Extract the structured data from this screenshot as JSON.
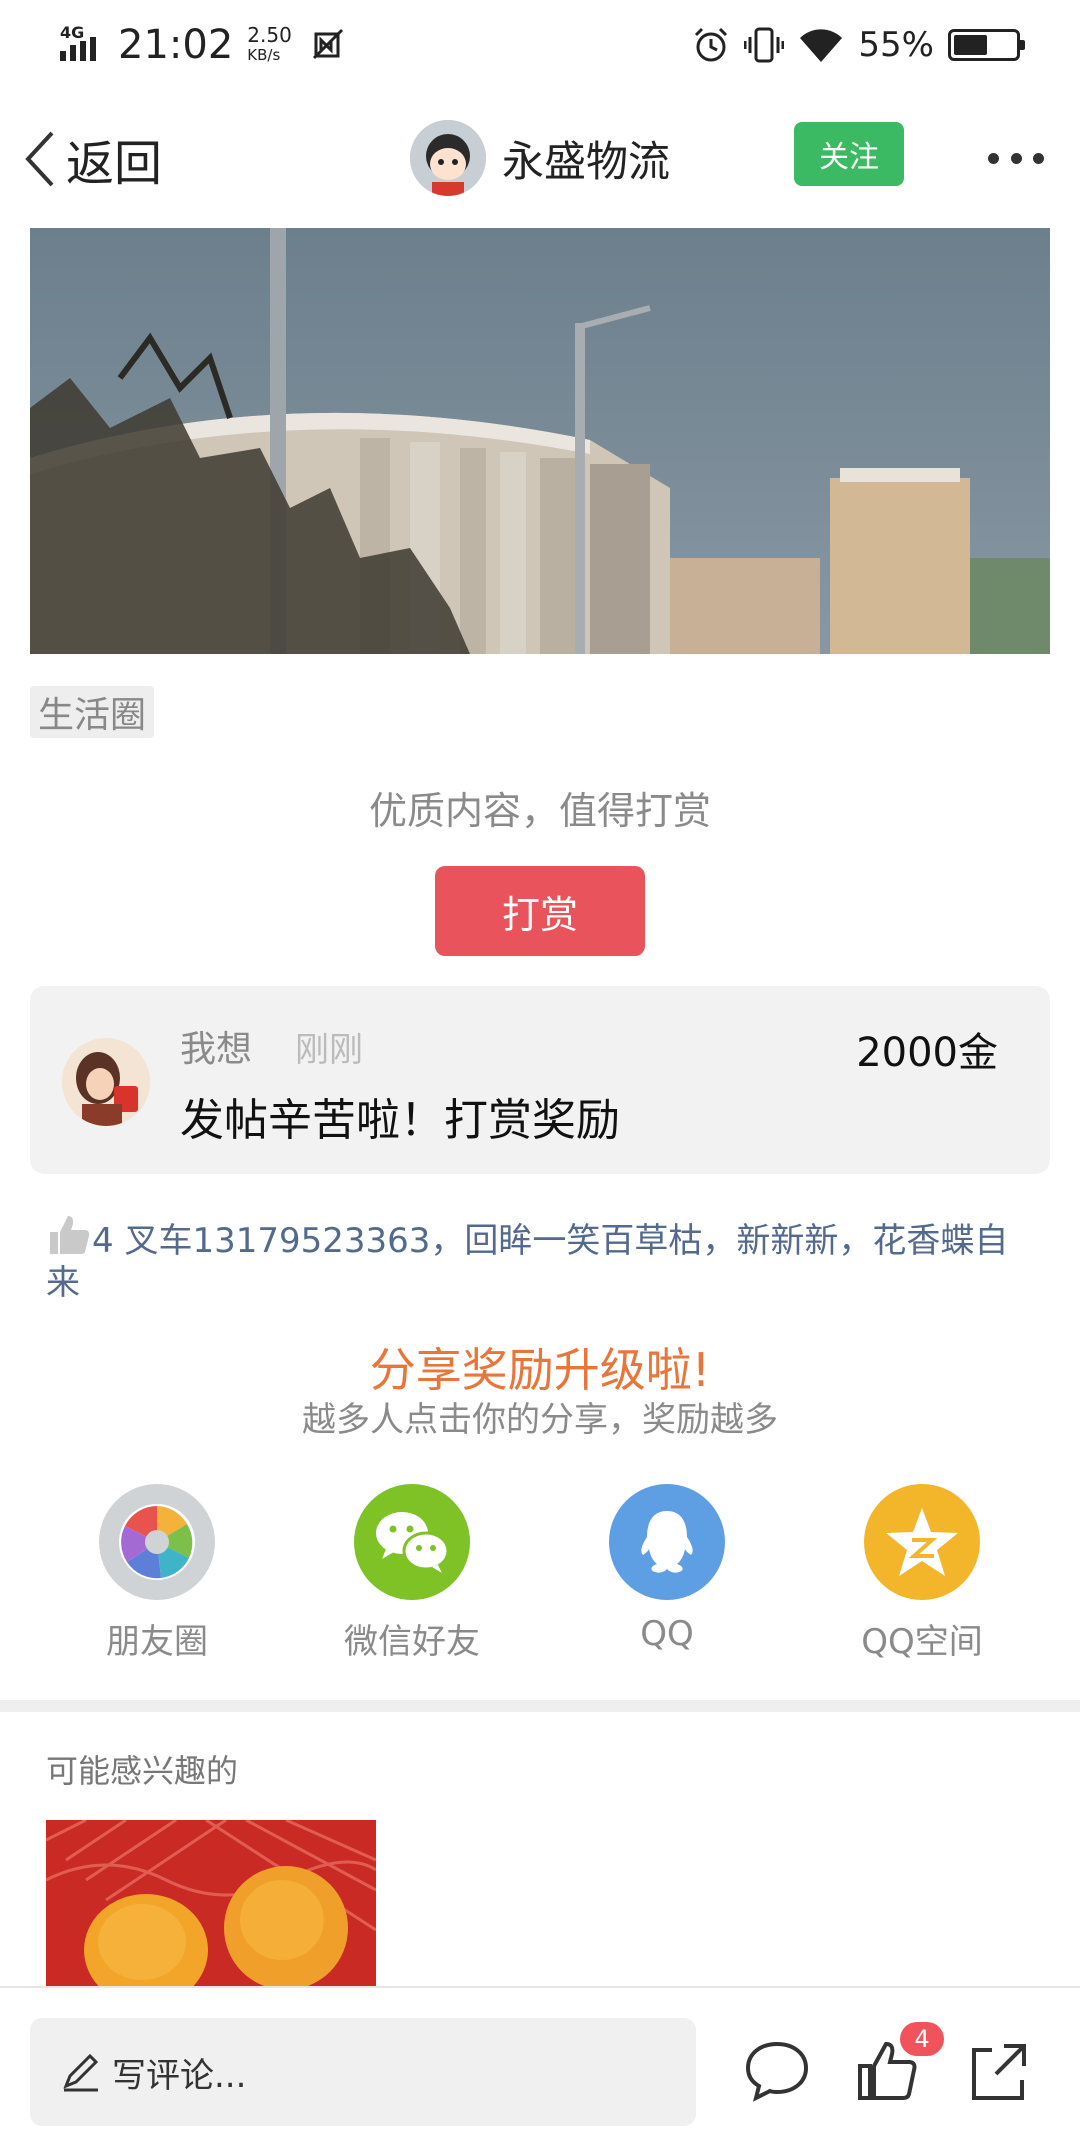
{
  "status_bar": {
    "network": "4G",
    "time": "21:02",
    "speed_value": "2.50",
    "speed_unit": "KB/s",
    "battery_text": "55%",
    "battery_level": 0.55
  },
  "header": {
    "back_label": "返回",
    "author_name": "永盛物流",
    "follow_label": "关注"
  },
  "post": {
    "tag": "生活圈"
  },
  "reward": {
    "hint": "优质内容，值得打赏",
    "button_label": "打赏",
    "record": {
      "name": "我想",
      "time": "刚刚",
      "amount": "2000金",
      "message": "发帖辛苦啦！打赏奖励"
    }
  },
  "likes": {
    "count": "4",
    "names": " 叉车13179523363，回眸一笑百草枯，新新新，花香蝶自来"
  },
  "share": {
    "title": "分享奖励升级啦!",
    "subtitle": "越多人点击你的分享，奖励越多",
    "targets": [
      {
        "label": "朋友圈",
        "icon": "moments-icon",
        "color": "#d0d3d6"
      },
      {
        "label": "微信好友",
        "icon": "wechat-icon",
        "color": "#7ec225"
      },
      {
        "label": "QQ",
        "icon": "qq-icon",
        "color": "#5e9ee3"
      },
      {
        "label": "QQ空间",
        "icon": "qzone-icon",
        "color": "#f3b62b"
      }
    ]
  },
  "related": {
    "title": "可能感兴趣的"
  },
  "bottom_bar": {
    "comment_placeholder": "写评论...",
    "like_badge": "4"
  },
  "colors": {
    "follow_green": "#3cb963",
    "reward_red": "#e9535b",
    "share_orange": "#e8763a",
    "like_blue": "#53698e"
  }
}
